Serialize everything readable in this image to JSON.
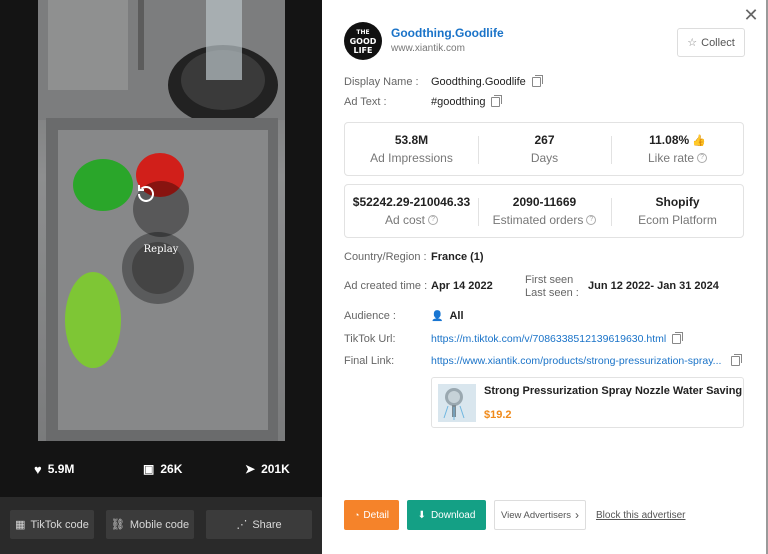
{
  "video": {
    "replay_label": "Replay"
  },
  "engagement": {
    "likes": "5.9M",
    "comments": "26K",
    "shares": "201K"
  },
  "bottom_buttons": {
    "tiktok_code": "TikTok code",
    "mobile_code": "Mobile code",
    "share": "Share"
  },
  "advertiser": {
    "logo_text": [
      "THE",
      "GOOD",
      "LIFE"
    ],
    "name": "Goodthing.Goodlife",
    "site": "www.xiantik.com",
    "collect_label": "Collect"
  },
  "fields": {
    "display_name_label": "Display Name :",
    "display_name_value": "Goodthing.Goodlife",
    "ad_text_label": "Ad Text :",
    "ad_text_value": "#goodthing",
    "country_label": "Country/Region :",
    "country_value": "France (1)",
    "created_label": "Ad created time :",
    "created_value": "Apr 14 2022",
    "first_seen_label": "First seen",
    "last_seen_label": "Last seen :",
    "seen_range": "Jun 12 2022- Jan 31 2024",
    "audience_label": "Audience :",
    "audience_value": "All",
    "tiktok_url_label": "TikTok Url:",
    "tiktok_url_value": "https://m.tiktok.com/v/7086338512139619630.html",
    "final_link_label": "Final Link:",
    "final_link_value": "https://www.xiantik.com/products/strong-pressurization-spray..."
  },
  "metrics_1": [
    {
      "value": "53.8M",
      "label": "Ad Impressions"
    },
    {
      "value": "267",
      "label": "Days"
    },
    {
      "value": "11.08%",
      "label": "Like rate"
    }
  ],
  "metrics_2": [
    {
      "value": "$52242.29-210046.33",
      "label": "Ad cost"
    },
    {
      "value": "2090-11669",
      "label": "Estimated orders"
    },
    {
      "value": "Shopify",
      "label": "Ecom Platform"
    }
  ],
  "product": {
    "title": "Strong Pressurization Spray Nozzle Water Saving Ra",
    "price": "$19.2"
  },
  "actions": {
    "detail": "Detail",
    "download": "Download",
    "view_advertisers": "View Advertisers",
    "block": "Block this advertiser"
  },
  "colors": {
    "brand_link": "#1a73c8",
    "detail_button": "#f5832a",
    "download_button": "#14a085",
    "price": "#f08a1a"
  }
}
